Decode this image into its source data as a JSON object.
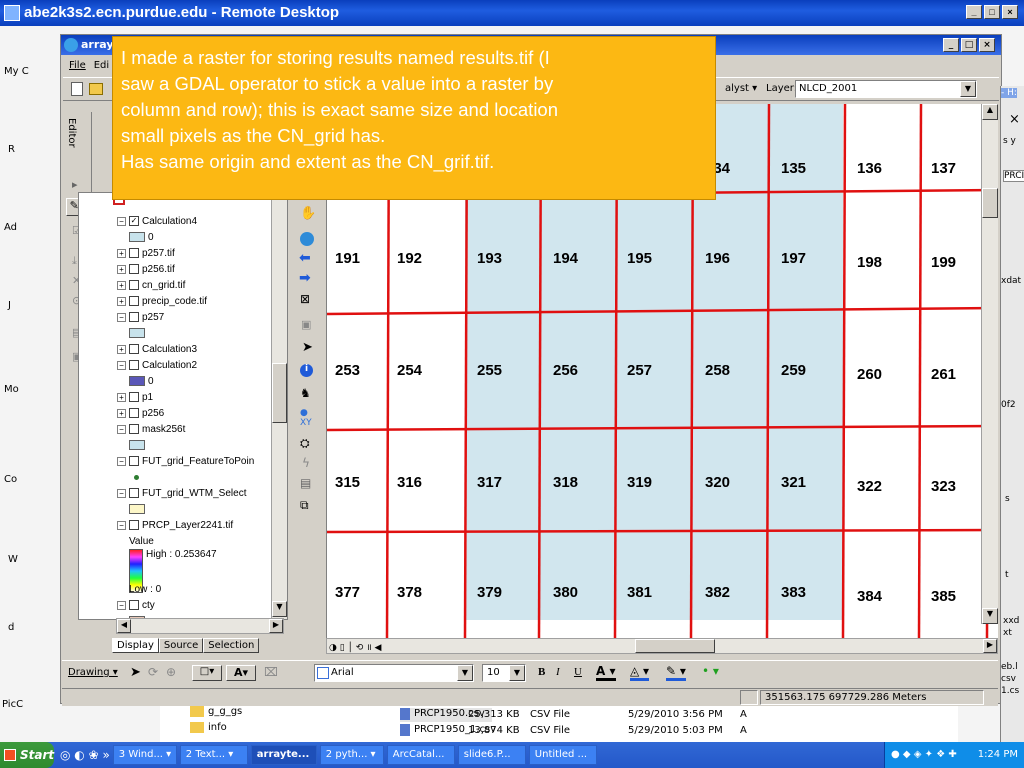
{
  "remote_title": "abe2k3s2.ecn.purdue.edu - Remote Desktop",
  "arc_title": "arrayte...",
  "desktop_labels": [
    "My C",
    "R",
    "Ad",
    "J",
    "Mo",
    "Co",
    "W",
    "d",
    "PicC"
  ],
  "menu": {
    "file": "File",
    "edit": "Edi"
  },
  "toolbar": {
    "analyst": "alyst ▾",
    "layer_label": "Layer:",
    "layer_value": "NLCD_2001"
  },
  "editor_tab": "Editor",
  "toc": {
    "tabs": [
      "Display",
      "Source",
      "Selection"
    ],
    "layers": [
      {
        "pm": "⊟",
        "cb": "✓",
        "name": "Calculation4"
      },
      {
        "swatch": "#c8e3ec",
        "name": "0"
      },
      {
        "pm": "⊞",
        "cb": "",
        "name": "p257.tif"
      },
      {
        "pm": "⊞",
        "cb": "",
        "name": "p256.tif"
      },
      {
        "pm": "⊞",
        "cb": "",
        "name": "cn_grid.tif"
      },
      {
        "pm": "⊞",
        "cb": "",
        "name": "precip_code.tif"
      },
      {
        "pm": "⊟",
        "cb": "",
        "name": "p257"
      },
      {
        "swatch": "#c8e3ec",
        "name": ""
      },
      {
        "pm": "⊞",
        "cb": "",
        "name": "Calculation3"
      },
      {
        "pm": "⊟",
        "cb": "",
        "name": "Calculation2"
      },
      {
        "swatch": "#5a57b8",
        "name": "0"
      },
      {
        "pm": "⊞",
        "cb": "",
        "name": "p1"
      },
      {
        "pm": "⊞",
        "cb": "",
        "name": "p256"
      },
      {
        "pm": "⊟",
        "cb": "",
        "name": "mask256t"
      },
      {
        "swatch": "#c8e3ec",
        "name": ""
      },
      {
        "pm": "⊟",
        "cb": "",
        "name": "FUT_grid_FeatureToPoin"
      },
      {
        "dot": "#2e7d32",
        "name": ""
      },
      {
        "pm": "⊟",
        "cb": "",
        "name": "FUT_grid_WTM_Select"
      },
      {
        "swatch": "#fdf7c8",
        "name": ""
      },
      {
        "pm": "⊟",
        "cb": "",
        "name": "PRCP_Layer2241.tif"
      },
      {
        "name": "Value"
      },
      {
        "gradient": true,
        "name": "High : 0.253647"
      },
      {
        "name": ""
      },
      {
        "name": "Low : 0"
      },
      {
        "pm": "⊟",
        "cb": "",
        "name": "cty"
      },
      {
        "swatch": "#e8c8b8",
        "name": ""
      }
    ]
  },
  "note": {
    "lines": [
      "I made a raster for storing results named results.tif (I",
      "saw a GDAL operator to stick a value into a raster by",
      "column and row); this is exact same size and location",
      "small pixels as the CN_grid has.",
      "Has same origin and extent as the CN_grif.tif."
    ]
  },
  "map_rows": [
    [
      "134",
      "135",
      "136",
      "137"
    ],
    [
      "191",
      "192",
      "193",
      "194",
      "195",
      "196",
      "197",
      "198",
      "199"
    ],
    [
      "253",
      "254",
      "255",
      "256",
      "257",
      "258",
      "259",
      "260",
      "261"
    ],
    [
      "315",
      "316",
      "317",
      "318",
      "319",
      "320",
      "321",
      "322",
      "323"
    ],
    [
      "377",
      "378",
      "379",
      "380",
      "381",
      "382",
      "383",
      "384",
      "385"
    ]
  ],
  "drawing": {
    "label": "Drawing ▾",
    "font": "Arial",
    "size": "10",
    "b": "B",
    "i": "I",
    "u": "U"
  },
  "coords": "351563.175 697729.286 Meters",
  "file_rows": [
    {
      "icon": "folder",
      "name": "g_g_gs",
      "name2": "PRCP1950.csv",
      "size": "25,313 KB",
      "type": "CSV File",
      "date": "5/29/2010 3:56 PM",
      "attr": "A"
    },
    {
      "icon": "folder",
      "name": "info",
      "name2": "PRCP1950_1.csv",
      "size": "13,874 KB",
      "type": "CSV File",
      "date": "5/29/2010 5:03 PM",
      "attr": "A"
    }
  ],
  "right_edge": [
    "- H:",
    "×",
    "s y",
    "PRCI",
    "xdat",
    "0f2",
    "s",
    "t",
    "xxd",
    "xt",
    "eb.l",
    "csv",
    "1.cs"
  ],
  "taskbar": {
    "start": "Start",
    "tasks": [
      "3 Wind... ▾",
      "2 Text... ▾",
      "arrayte...",
      "2 pyth... ▾",
      "ArcCatal...",
      "slide6.P...",
      "Untitled ..."
    ],
    "clock": "1:24 PM"
  },
  "colors": {
    "highlight": "#d1e6ee",
    "grid_line": "#e01010",
    "note_bg": "#fcb813",
    "xp_blue": "#0a3fbd"
  }
}
